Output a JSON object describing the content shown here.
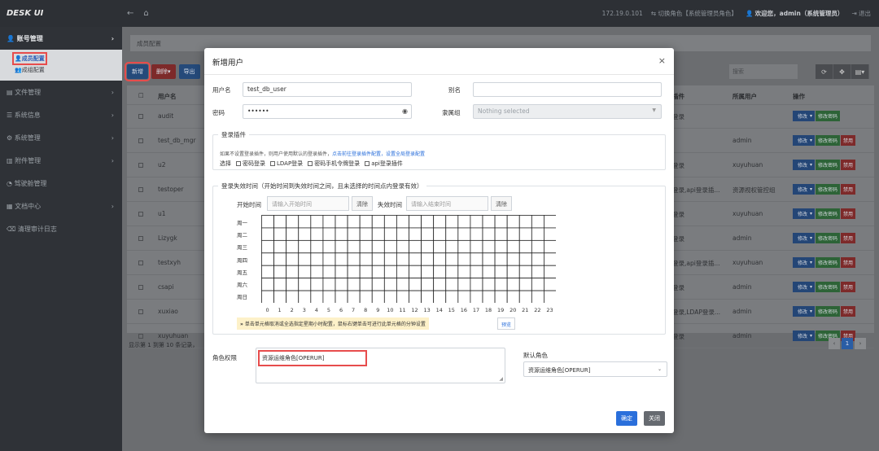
{
  "topbar": {
    "logo": "DESK UI",
    "ip": "172.19.0.101",
    "switch_role": "切换角色【系统管理员角色】",
    "welcome": "欢迎您，admin（系统管理员）",
    "logout": "退出"
  },
  "sidebar": {
    "items": [
      {
        "label": "账号管理"
      },
      {
        "label": "文件管理"
      },
      {
        "label": "系统信息"
      },
      {
        "label": "系统管理"
      },
      {
        "label": "附件管理"
      },
      {
        "label": "驾驶舱管理"
      },
      {
        "label": "文档中心"
      },
      {
        "label": "清理审计日志"
      }
    ],
    "sub_items": [
      {
        "label": "成员配置"
      },
      {
        "label": "成组配置"
      }
    ]
  },
  "main": {
    "breadcrumb": "成员配置",
    "toolbar": {
      "add": "新增",
      "delete": "删除",
      "export": "导出"
    },
    "search_placeholder": "搜索",
    "table": {
      "headers": {
        "name": "用户名",
        "plugin": "插件",
        "owner": "所属用户",
        "ops": "操作"
      },
      "rows": [
        {
          "name": "audit",
          "plugin": "登录",
          "owner": ""
        },
        {
          "name": "test_db_mgr",
          "plugin": "",
          "owner": "admin"
        },
        {
          "name": "u2",
          "plugin": "登录",
          "owner": "xuyuhuan"
        },
        {
          "name": "testoper",
          "plugin": "登录,api登录插...",
          "owner": "资源视权管控组"
        },
        {
          "name": "u1",
          "plugin": "登录",
          "owner": "xuyuhuan"
        },
        {
          "name": "Lizygk",
          "plugin": "登录",
          "owner": "admin"
        },
        {
          "name": "testxyh",
          "plugin": "登录,api登录插...",
          "owner": "xuyuhuan"
        },
        {
          "name": "csapi",
          "plugin": "登录",
          "owner": "admin"
        },
        {
          "name": "xuxiao",
          "plugin": "登录,LDAP登录...",
          "owner": "admin"
        },
        {
          "name": "xuyuhuan",
          "plugin": "登录",
          "owner": "admin"
        }
      ],
      "op_labels": {
        "edit": "修改",
        "change_pwd": "修改密码",
        "disable": "禁用"
      }
    },
    "footer": "显示第 1 到第 10 条记录，",
    "pager": {
      "prev": "‹",
      "current": "1",
      "next": "›"
    }
  },
  "modal": {
    "title": "新增用户",
    "close": "×",
    "username_label": "用户名",
    "username_value": "test_db_user",
    "alias_label": "别名",
    "alias_value": "",
    "password_label": "密码",
    "password_value": "••••••",
    "group_label": "隶属组",
    "group_value": "Nothing selected",
    "plugin_legend": "登录插件",
    "plugin_hint": "如果不设置登录插件，则用户使用默认的登录插件，",
    "plugin_hint_link": "点击前往登录插件配置，设置全局登录配置",
    "plugin_select_label": "选择",
    "plugins": [
      "密码登录",
      "LDAP登录",
      "密码手机令牌登录",
      "api登录插件"
    ],
    "time_legend": "登录失效时间（开始时间到失效时间之间，且未选择的时间点内登录有效）",
    "start_label": "开始时间",
    "start_placeholder": "请输入开始时间",
    "clear": "清除",
    "end_label": "失效时间",
    "end_placeholder": "请输入结束时间",
    "days": [
      "周一",
      "周二",
      "周三",
      "周四",
      "周五",
      "周六",
      "周日"
    ],
    "hours": [
      "0",
      "1",
      "2",
      "3",
      "4",
      "5",
      "6",
      "7",
      "8",
      "9",
      "10",
      "11",
      "12",
      "13",
      "14",
      "15",
      "16",
      "17",
      "18",
      "19",
      "20",
      "21",
      "22",
      "23"
    ],
    "tip_prefix": "»",
    "tip": "单击单元格取消或全选指定星期小时配置，鼠标右键单击可进行此单元格的分钟设置",
    "preview": "预览",
    "role_label": "角色权限",
    "role_value": "资源运维角色[OPERUR]",
    "default_role_label": "默认角色",
    "default_role_value": "资源运维角色[OPERUR]",
    "ok": "确定",
    "cancel": "关闭"
  }
}
